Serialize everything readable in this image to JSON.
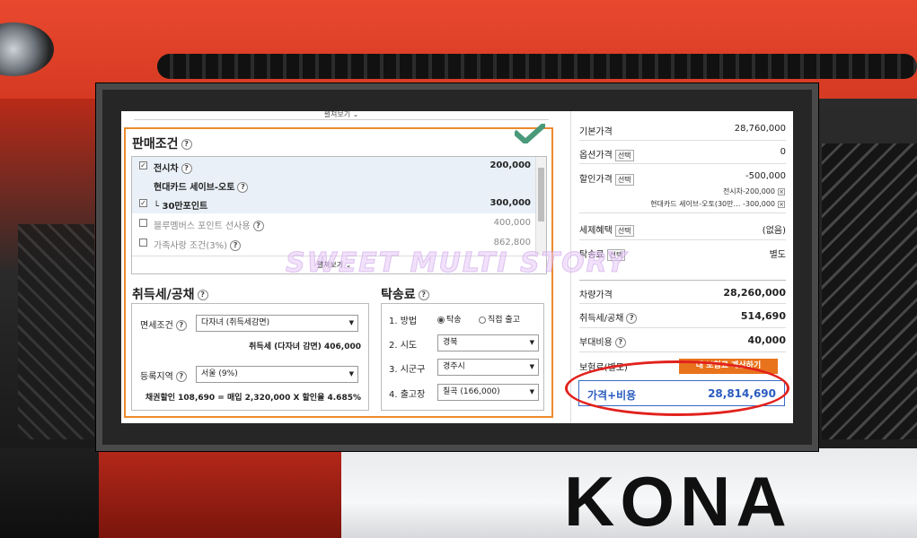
{
  "background": {
    "plate_text": "KONA"
  },
  "watermark": "SWEET MULTI STORY",
  "sales": {
    "fold_label": "펼쳐보기",
    "title": "판매조건",
    "help": "?",
    "items": [
      {
        "label": "전시차",
        "amount": "200,000",
        "checked": true
      },
      {
        "label": "현대카드 세이브-오토",
        "amount": "",
        "checked": false
      },
      {
        "label": "└ 30만포인트",
        "amount": "300,000",
        "checked": true
      },
      {
        "label": "블루멤버스 포인트 선사용",
        "amount": "400,000",
        "checked": false
      },
      {
        "label": "가족사랑 조건(3%)",
        "amount": "862,800",
        "checked": false
      }
    ],
    "fold_inner": "펼쳐보기"
  },
  "tax": {
    "title": "취득세/공채",
    "exempt_label": "면세조건",
    "exempt_value": "다자녀 (취득세감면)",
    "tax_note": "취득세 (다자녀 감면) 406,000",
    "region_label": "등록지역",
    "region_value": "서울 (9%)",
    "bond_note": "채권할인 108,690 = 매입 2,320,000 X 할인율 4.685%"
  },
  "delivery": {
    "title": "탁송료",
    "method_label": "1. 방법",
    "method_opt1": "탁송",
    "method_opt2": "직접 출고",
    "province_label": "2. 시도",
    "province_value": "경북",
    "city_label": "3. 시군구",
    "city_value": "경주시",
    "factory_label": "4. 출고장",
    "factory_value": "칠곡 (166,000)"
  },
  "price": {
    "base_label": "기본가격",
    "base_value": "28,760,000",
    "option_label": "옵션가격",
    "option_value": "0",
    "discount_label": "할인가격",
    "discount_value": "-500,000",
    "discount_sub1": "전시차-200,000",
    "discount_sub2": "현대카드 세이브-오토(30만… -300,000",
    "tax_benefit_label": "세제혜택",
    "tax_benefit_value": "(없음)",
    "delivery_label": "탁송료",
    "delivery_value": "별도",
    "select_badge": "선택",
    "x_mark": "×",
    "car_price_label": "차량가격",
    "car_price_value": "28,260,000",
    "acq_tax_label": "취득세/공채",
    "acq_tax_value": "514,690",
    "extra_label": "부대비용",
    "extra_value": "40,000",
    "insurance_label": "보험료(별도)",
    "insurance_btn": "내 보험료 계산하기",
    "total_label": "가격+비용",
    "total_value": "28,814,690"
  },
  "colors": {
    "accent_orange": "#ec8b2e",
    "total_blue": "#2a5bbf",
    "highlight_red": "#e2211c",
    "check_green": "#4a9a7a"
  }
}
